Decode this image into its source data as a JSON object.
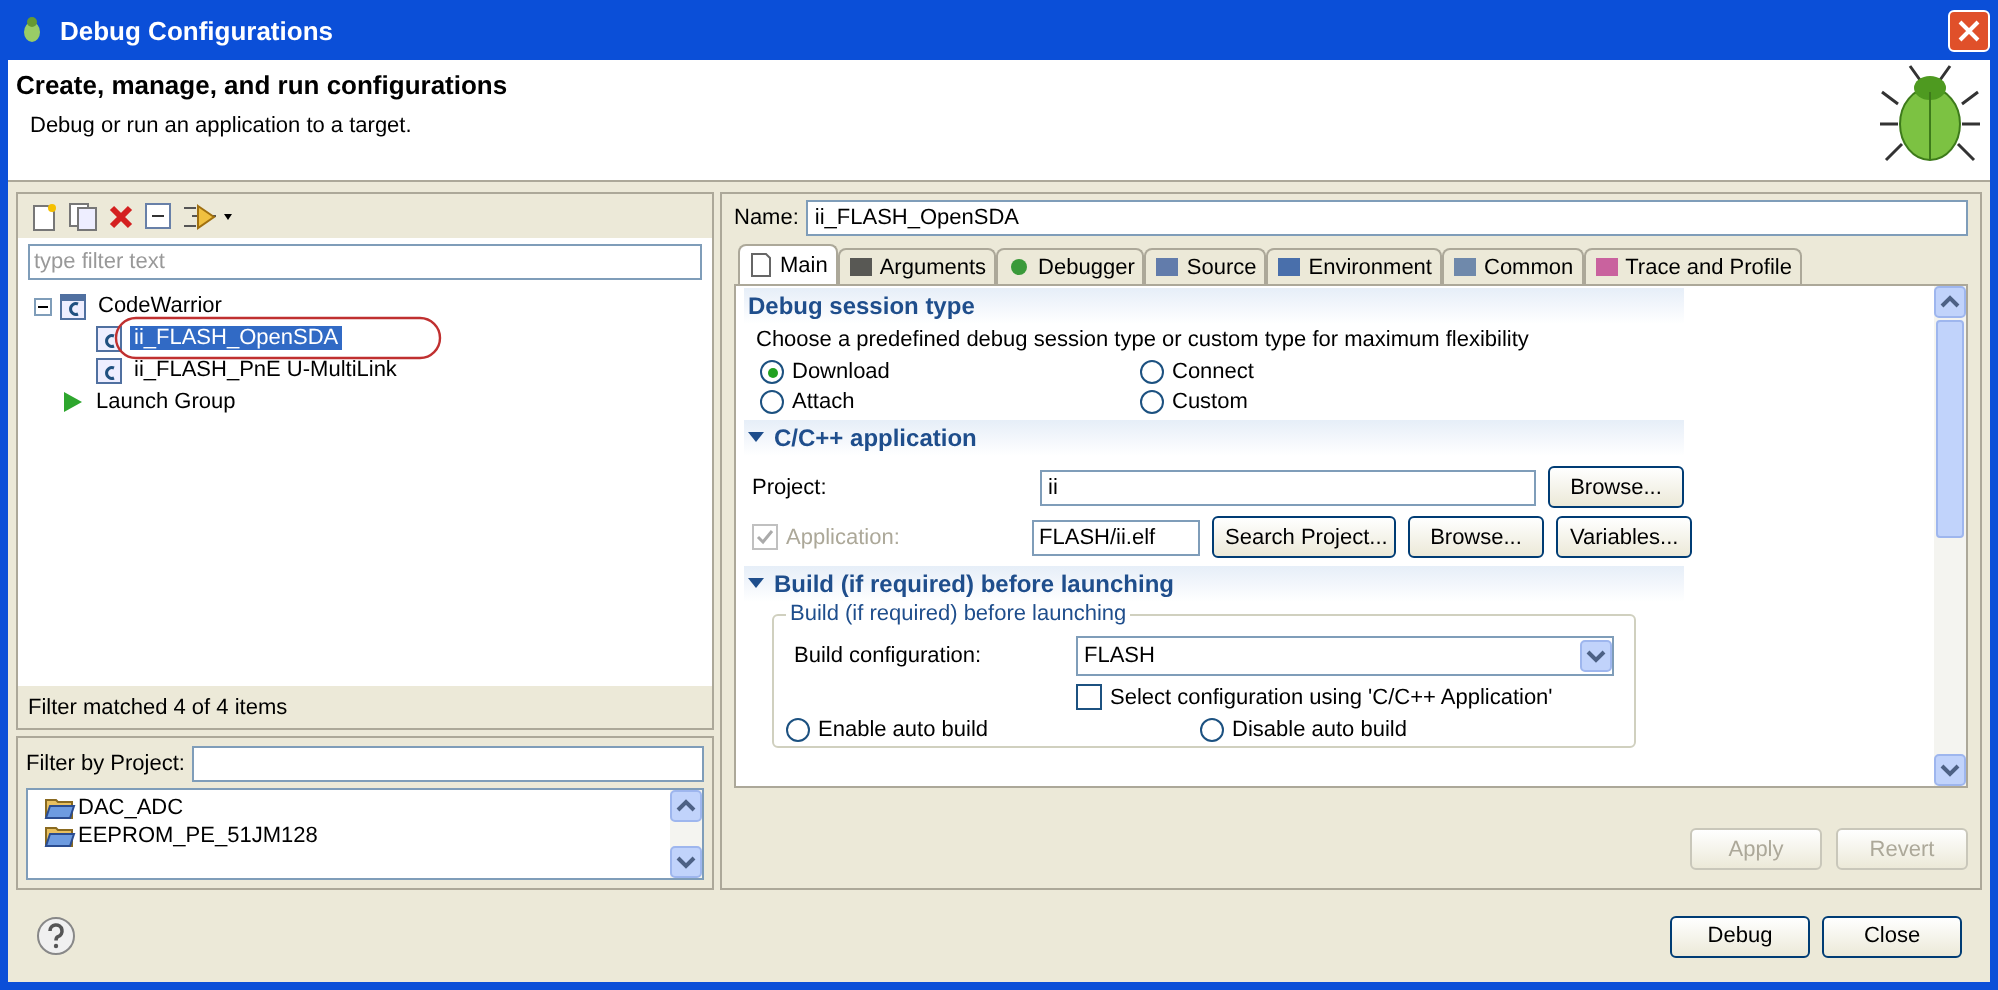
{
  "window": {
    "title": "Debug Configurations"
  },
  "header": {
    "title": "Create, manage, and run configurations",
    "subtitle": "Debug or run an application to a target."
  },
  "left": {
    "filter_placeholder": "type filter text",
    "tree": [
      {
        "label": "CodeWarrior",
        "kind": "type",
        "expanded": true,
        "selected": false,
        "children": [
          {
            "label": "ii_FLASH_OpenSDA",
            "kind": "config",
            "selected": true,
            "annotated": true
          },
          {
            "label": "ii_FLASH_PnE U-MultiLink",
            "kind": "config",
            "selected": false,
            "annotated": false
          }
        ]
      },
      {
        "label": "Launch Group",
        "kind": "launch",
        "selected": false
      }
    ],
    "status": "Filter matched 4 of 4 items",
    "project_filter_label": "Filter by Project:",
    "projects": [
      "DAC_ADC",
      "EEPROM_PE_51JM128"
    ]
  },
  "right": {
    "name_label": "Name:",
    "name": "ii_FLASH_OpenSDA",
    "tabs": [
      {
        "label": "Main",
        "selected": true
      },
      {
        "label": "Arguments",
        "selected": false
      },
      {
        "label": "Debugger",
        "selected": false
      },
      {
        "label": "Source",
        "selected": false
      },
      {
        "label": "Environment",
        "selected": false
      },
      {
        "label": "Common",
        "selected": false
      },
      {
        "label": "Trace and Profile",
        "selected": false
      }
    ],
    "session": {
      "title": "Debug session type",
      "description": "Choose a predefined debug session type or custom type for maximum flexibility",
      "options": [
        {
          "label": "Download",
          "selected": true
        },
        {
          "label": "Connect",
          "selected": false
        },
        {
          "label": "Attach",
          "selected": false
        },
        {
          "label": "Custom",
          "selected": false
        }
      ]
    },
    "application": {
      "title": "C/C++ application",
      "project_label": "Project:",
      "project": "ii",
      "project_button": "Browse...",
      "app_label": "Application:",
      "app_checked": true,
      "app_disabled": true,
      "app": "FLASH/ii.elf",
      "buttons": [
        "Search Project...",
        "Browse...",
        "Variables..."
      ]
    },
    "build": {
      "title": "Build (if required) before launching",
      "group_title": "Build (if required) before launching",
      "config_label": "Build configuration:",
      "config": "FLASH",
      "checkbox": {
        "label": "Select configuration using 'C/C++ Application'",
        "checked": false
      },
      "options": [
        {
          "label": "Enable auto build",
          "selected": false
        },
        {
          "label": "Disable auto build",
          "selected": false
        }
      ]
    },
    "actions": [
      {
        "label": "Apply",
        "disabled": true
      },
      {
        "label": "Revert",
        "disabled": true
      }
    ]
  },
  "footer": {
    "buttons": [
      "Debug",
      "Close"
    ]
  }
}
